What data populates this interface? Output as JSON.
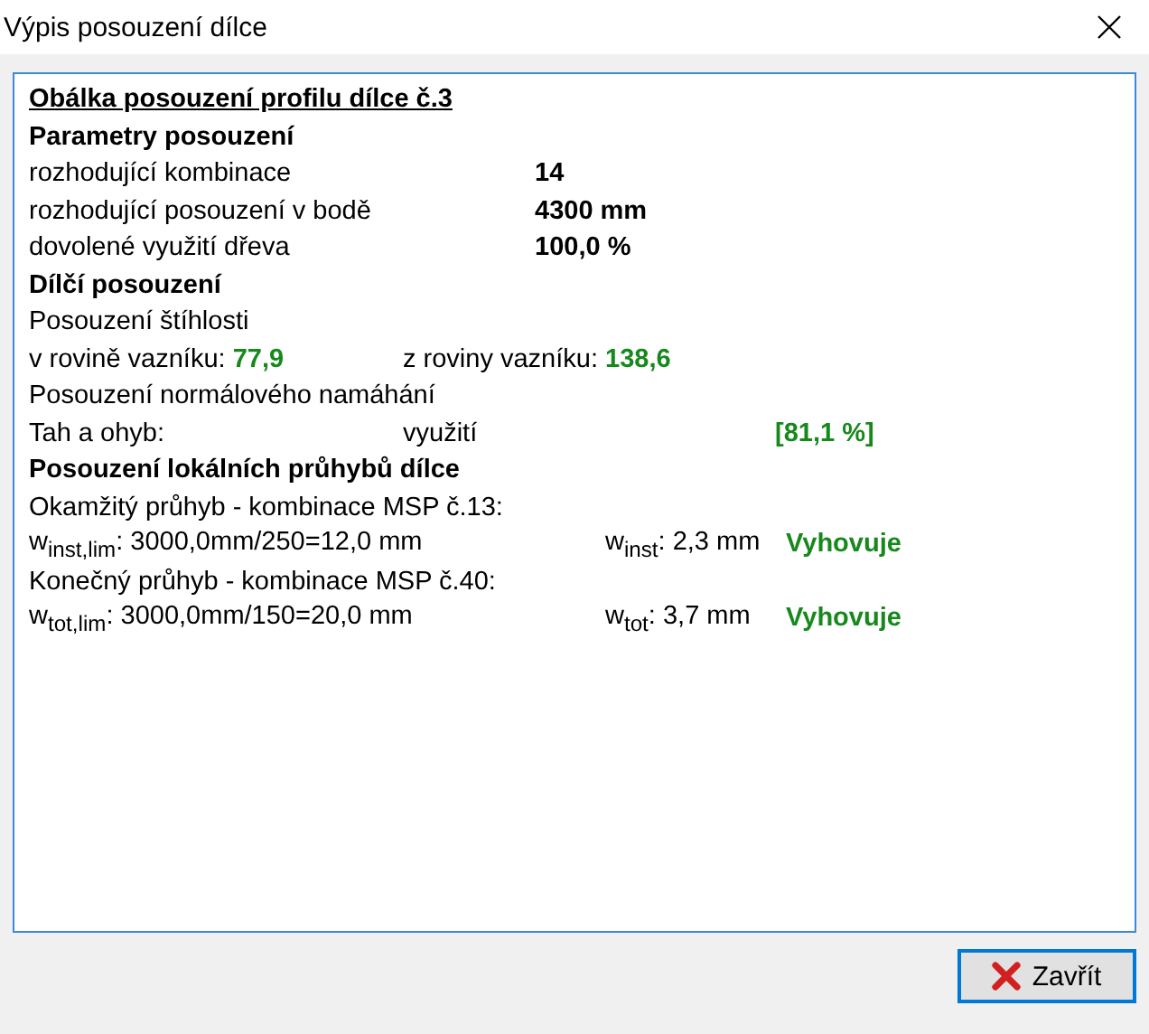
{
  "window": {
    "title": "Výpis posouzení dílce"
  },
  "report": {
    "heading": "Obálka posouzení profilu dílce č.3",
    "sections": [
      {
        "title": "Parametry posouzení",
        "rows": [
          {
            "kind": "param",
            "label": "rozhodující kombinace",
            "value": "14"
          },
          {
            "kind": "param",
            "label": "rozhodující posouzení v bodě",
            "value": "4300 mm"
          },
          {
            "kind": "param",
            "label": "dovolené využití dřeva",
            "value": "100,0 %"
          }
        ]
      },
      {
        "title": "Dílčí posouzení",
        "rows": [
          {
            "kind": "text",
            "label": "Posouzení štíhlosti"
          },
          {
            "kind": "pair",
            "items": [
              {
                "label": "v rovině vazníku:",
                "value": "77,9"
              },
              {
                "label": "z roviny vazníku:",
                "value": "138,6"
              }
            ]
          },
          {
            "kind": "text",
            "label": "Posouzení normálového namáhání"
          },
          {
            "kind": "usage",
            "label": "Tah a ohyb:",
            "middle": "využití",
            "value": "[81,1 %]"
          }
        ]
      },
      {
        "title": "Posouzení lokálních průhybů dílce",
        "rows": [
          {
            "kind": "text",
            "label": "Okamžitý průhyb - kombinace MSP č.13:"
          },
          {
            "kind": "check",
            "limit": "w$_{inst,lim}$: 3000,0mm/250=12,0 mm",
            "actual": "w$_{inst}$: 2,3 mm",
            "verdict": "Vyhovuje"
          },
          {
            "kind": "text",
            "label": "Konečný průhyb - kombinace MSP č.40:"
          },
          {
            "kind": "check",
            "limit": "w$_{tot,lim}$: 3000,0mm/150=20,0 mm",
            "actual": "w$_{tot}$: 3,7 mm",
            "verdict": "Vyhovuje"
          }
        ]
      }
    ]
  },
  "buttons": [
    {
      "label": "Zavřít"
    }
  ]
}
